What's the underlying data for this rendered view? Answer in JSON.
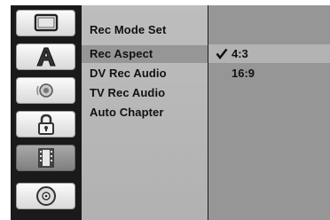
{
  "sidebar": {
    "icons": [
      {
        "name": "display-icon",
        "active": false
      },
      {
        "name": "language-icon",
        "active": false
      },
      {
        "name": "audio-icon",
        "active": false
      },
      {
        "name": "lock-icon",
        "active": false
      },
      {
        "name": "recording-icon",
        "active": true
      },
      {
        "name": "disc-icon",
        "active": false
      }
    ]
  },
  "menu": {
    "items": [
      {
        "label": "Rec Mode Set"
      },
      {
        "label": "Rec Aspect"
      },
      {
        "label": "DV Rec Audio"
      },
      {
        "label": "TV Rec Audio"
      },
      {
        "label": "Auto Chapter"
      }
    ],
    "selected": "Rec Aspect"
  },
  "options": {
    "items": [
      {
        "label": "4:3",
        "checked": true
      },
      {
        "label": "16:9",
        "checked": false
      }
    ]
  },
  "colors": {
    "background": "#1a1a1a",
    "menu_bg": "#b9b9b9",
    "highlight": "#969696",
    "option_highlight": "#b3b3b3"
  }
}
